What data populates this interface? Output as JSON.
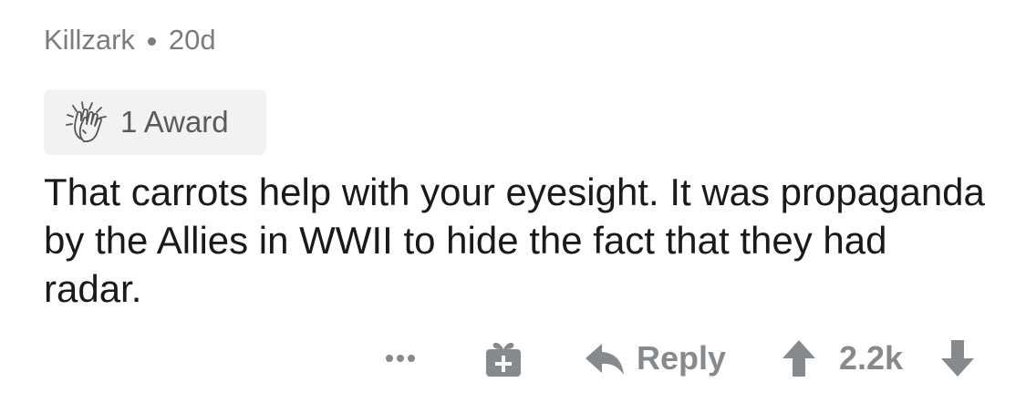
{
  "comment": {
    "author": "Killzark",
    "age": "20d",
    "award": {
      "icon": "clapping-hands-icon",
      "label": "1 Award"
    },
    "text": "That carrots help with your eyesight. It was propaganda by the Allies in WWII to hide the fact that they had radar."
  },
  "actions": {
    "more_icon": "more-dots-icon",
    "gift_icon": "gift-icon",
    "reply_icon": "reply-arrow-icon",
    "reply_label": "Reply",
    "upvote_icon": "upvote-arrow-icon",
    "score": "2.2k",
    "downvote_icon": "downvote-arrow-icon"
  },
  "colors": {
    "meta_text": "#7c7c7c",
    "body_text": "#1a1a1b",
    "action_gray": "#878a8c",
    "award_chip_bg": "#f2f2f2"
  }
}
